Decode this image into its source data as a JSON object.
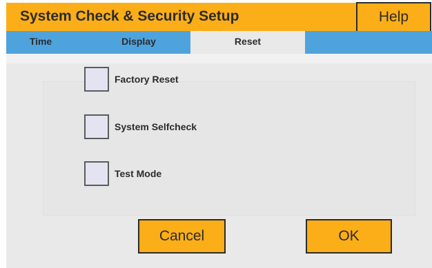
{
  "window": {
    "title": "System Check & Security Setup",
    "help_label": "Help"
  },
  "tabs": [
    {
      "label": "Time",
      "active": false
    },
    {
      "label": "Display",
      "active": false
    },
    {
      "label": "Reset",
      "active": true
    }
  ],
  "options": [
    {
      "label": "Factory Reset",
      "checked": false
    },
    {
      "label": "System Selfcheck",
      "checked": false
    },
    {
      "label": "Test Mode",
      "checked": false
    }
  ],
  "buttons": {
    "cancel_label": "Cancel",
    "ok_label": "OK"
  },
  "colors": {
    "accent": "#fbae17",
    "tabbar": "#4fa3dd",
    "panel": "#e9e9e9",
    "checkbox_fill": "#e4e3f1"
  }
}
